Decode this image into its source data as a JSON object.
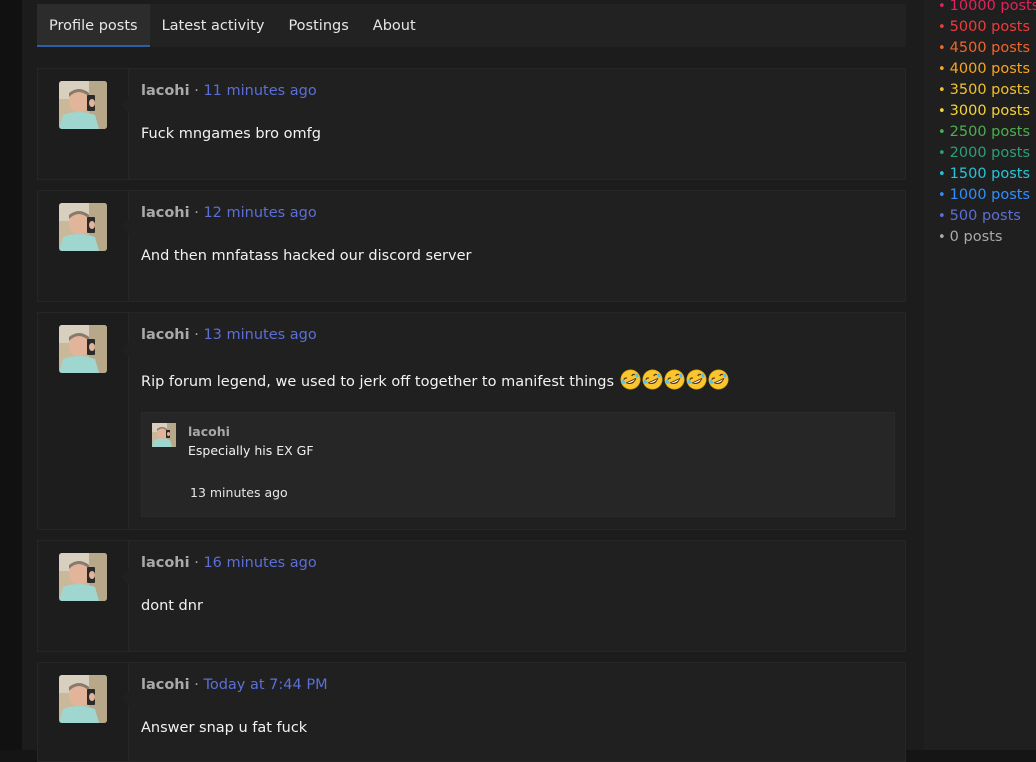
{
  "tabs": [
    {
      "label": "Profile posts",
      "active": true
    },
    {
      "label": "Latest activity",
      "active": false
    },
    {
      "label": "Postings",
      "active": false
    },
    {
      "label": "About",
      "active": false
    }
  ],
  "posts": [
    {
      "user": "lacohi",
      "separator": "·",
      "time": "11 minutes ago",
      "text": "Fuck mngames bro omfg"
    },
    {
      "user": "lacohi",
      "separator": "·",
      "time": "12 minutes ago",
      "text": "And then mnfatass hacked our discord server"
    },
    {
      "user": "lacohi",
      "separator": "·",
      "time": "13 minutes ago",
      "text": "Rip forum legend, we used to jerk off together to manifest things",
      "emoji": [
        "rolling-on-floor-laughing",
        "rolling-on-floor-laughing",
        "rolling-on-floor-laughing",
        "rolling-on-floor-laughing",
        "rolling-on-floor-laughing"
      ],
      "comment": {
        "user": "lacohi",
        "text": "Especially his EX GF",
        "time": "13 minutes ago"
      }
    },
    {
      "user": "lacohi",
      "separator": "·",
      "time": "16 minutes ago",
      "text": "dont dnr"
    },
    {
      "user": "lacohi",
      "separator": "·",
      "time": "Today at 7:44 PM",
      "text": "Answer snap u fat fuck"
    }
  ],
  "legend": [
    {
      "label": "10000 posts",
      "color": "#e0245e"
    },
    {
      "label": "5000 posts",
      "color": "#ef3b3b"
    },
    {
      "label": "4500 posts",
      "color": "#f0652b"
    },
    {
      "label": "4000 posts",
      "color": "#f5a623"
    },
    {
      "label": "3500 posts",
      "color": "#f2c12e"
    },
    {
      "label": "3000 posts",
      "color": "#f5d33a"
    },
    {
      "label": "2500 posts",
      "color": "#4caf50"
    },
    {
      "label": "2000 posts",
      "color": "#2e9e7a"
    },
    {
      "label": "1500 posts",
      "color": "#26c6da"
    },
    {
      "label": "1000 posts",
      "color": "#2f8fff"
    },
    {
      "label": "500 posts",
      "color": "#5b6fd6"
    },
    {
      "label": "0 posts",
      "color": "#a9a9a9"
    }
  ],
  "legend_bullet": "•"
}
